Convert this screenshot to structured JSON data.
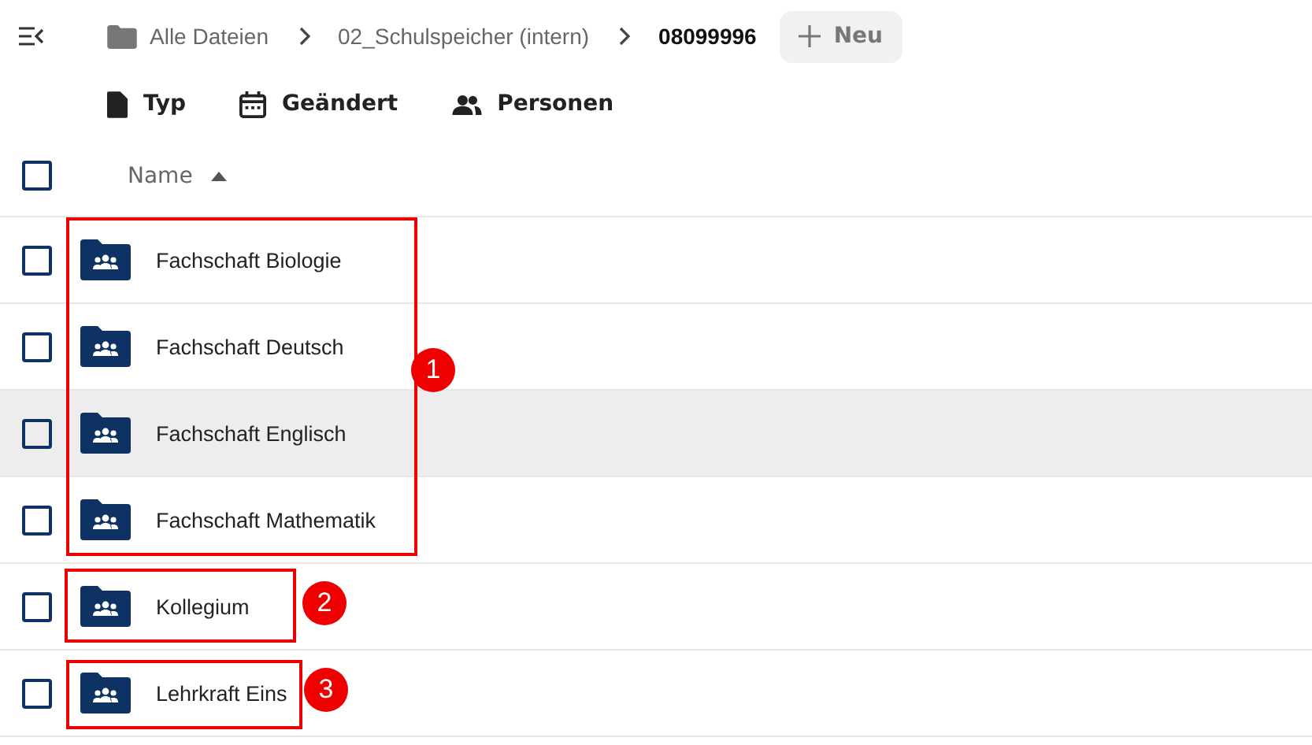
{
  "breadcrumbs": [
    {
      "label": "Alle Dateien",
      "kind": "root"
    },
    {
      "label": "02_Schulspeicher (intern)",
      "kind": "folder"
    },
    {
      "label": "08099996",
      "kind": "current"
    }
  ],
  "new_button": {
    "label": "Neu"
  },
  "filters": [
    {
      "label": "Typ",
      "kind": "type"
    },
    {
      "label": "Geändert",
      "kind": "date"
    },
    {
      "label": "Personen",
      "kind": "people"
    }
  ],
  "table": {
    "header": {
      "label": "Name",
      "checked": false
    },
    "rows": [
      {
        "name": "Fachschaft Biologie",
        "checked": false,
        "highlighted": false
      },
      {
        "name": "Fachschaft Deutsch",
        "checked": false,
        "highlighted": false
      },
      {
        "name": "Fachschaft Englisch",
        "checked": false,
        "highlighted": true
      },
      {
        "name": "Fachschaft Mathematik",
        "checked": false,
        "highlighted": false
      },
      {
        "name": "Kollegium",
        "checked": false,
        "highlighted": false
      },
      {
        "name": "Lehrkraft Eins",
        "checked": false,
        "highlighted": false
      }
    ]
  },
  "annotations": [
    {
      "label": "1"
    },
    {
      "label": "2"
    },
    {
      "label": "3"
    }
  ]
}
